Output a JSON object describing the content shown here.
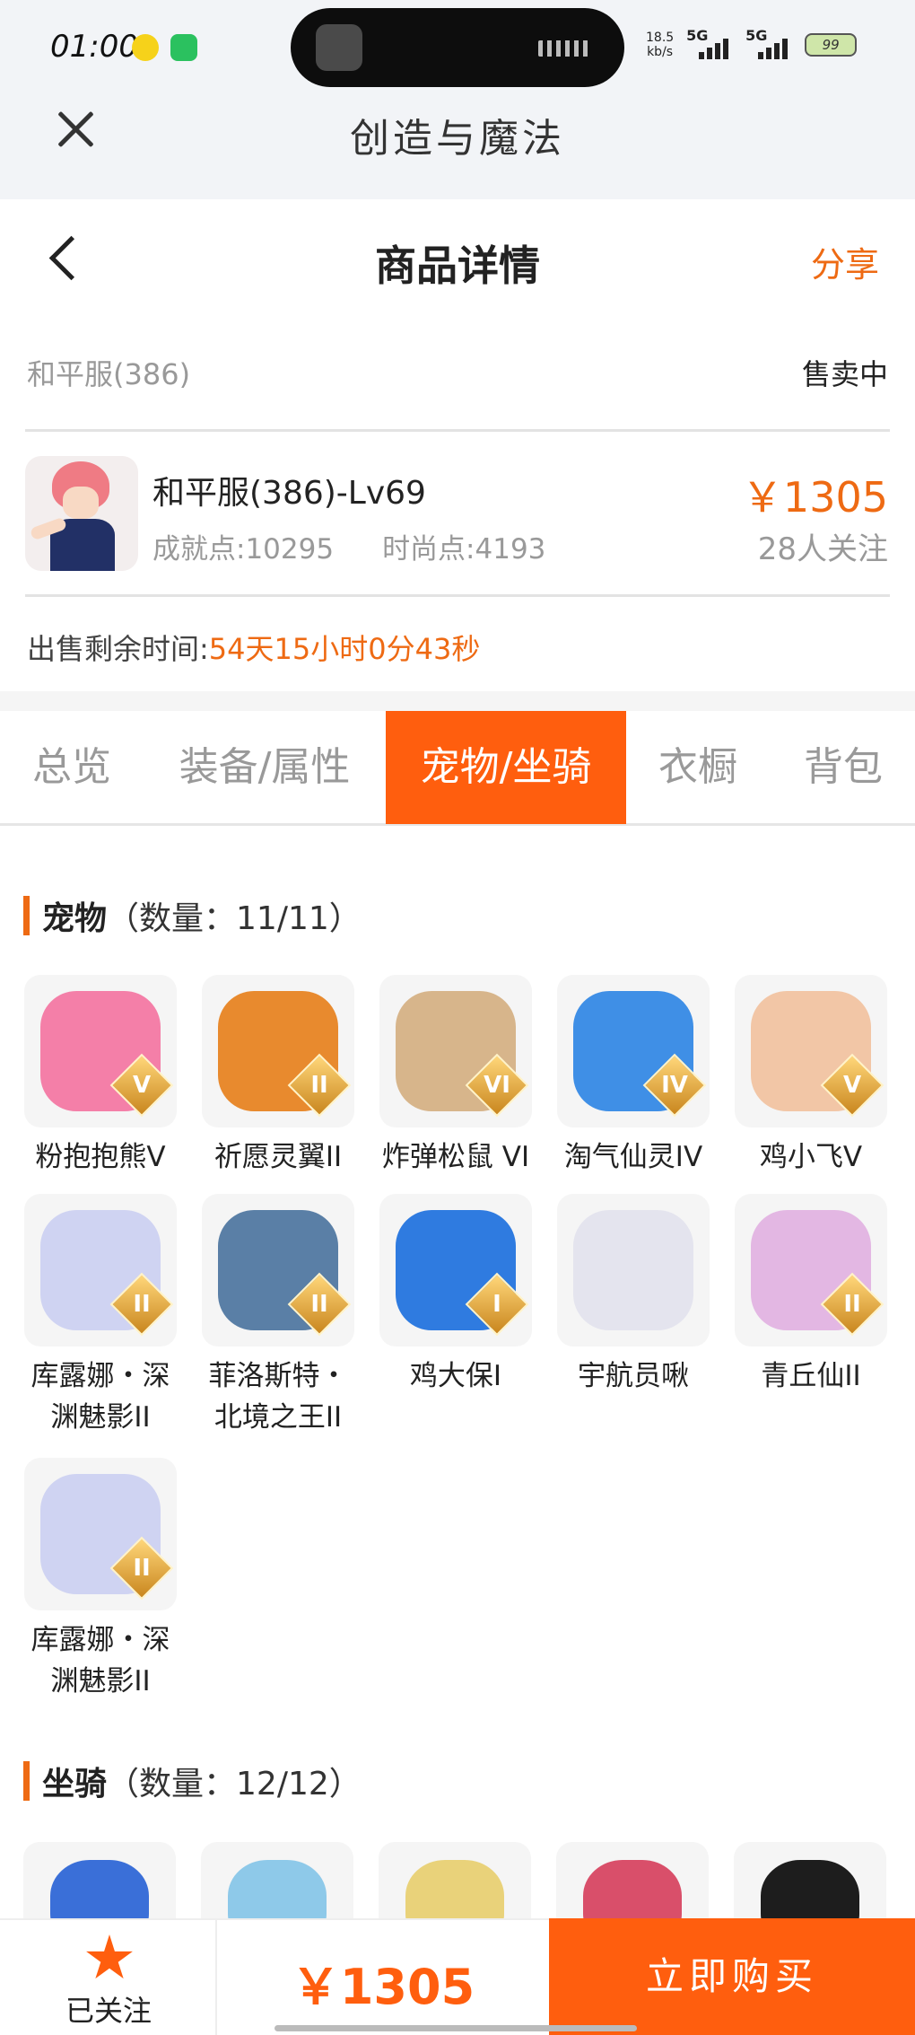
{
  "status_bar": {
    "time": "01:00",
    "speed": "18.5",
    "speed_unit": "kb/s",
    "net1": "5G",
    "net2": "5G",
    "battery": "99"
  },
  "app": {
    "title": "创造与魔法"
  },
  "header": {
    "title": "商品详情",
    "share": "分享"
  },
  "product": {
    "server": "和平服(386)",
    "status": "售卖中",
    "name": "和平服(386)-Lv69",
    "achievement": "成就点:10295",
    "fashion": "时尚点:4193",
    "price": "￥1305",
    "followers": "28人关注",
    "remain_label": "出售剩余时间:",
    "remain_value": "54天15小时0分43秒"
  },
  "tabs": [
    {
      "label": "总览",
      "active": false
    },
    {
      "label": "装备/属性",
      "active": false
    },
    {
      "label": "宠物/坐骑",
      "active": true
    },
    {
      "label": "衣橱",
      "active": false
    },
    {
      "label": "背包",
      "active": false
    }
  ],
  "pets_section": {
    "title": "宠物",
    "count": "（数量：11/11）"
  },
  "pets": [
    {
      "name": "粉抱抱熊Ⅴ",
      "rank": "V",
      "color": "#f47fa8"
    },
    {
      "name": "祈愿灵翼II",
      "rank": "II",
      "color": "#e88a2e"
    },
    {
      "name": "炸弹松鼠 VI",
      "rank": "VI",
      "color": "#d7b58b"
    },
    {
      "name": "淘气仙灵IV",
      "rank": "IV",
      "color": "#3f8fe6"
    },
    {
      "name": "鸡小飞V",
      "rank": "V",
      "color": "#f2c6a6"
    },
    {
      "name": "库露娜・深渊魅影II",
      "rank": "II",
      "color": "#cfd3f2"
    },
    {
      "name": "菲洛斯特・北境之王II",
      "rank": "II",
      "color": "#5a7fa6"
    },
    {
      "name": "鸡大保I",
      "rank": "I",
      "color": "#2f7be0"
    },
    {
      "name": "宇航员啾",
      "rank": "",
      "color": "#e4e4ee"
    },
    {
      "name": "青丘仙II",
      "rank": "II",
      "color": "#e3b7e3"
    },
    {
      "name": "库露娜・深渊魅影II",
      "rank": "II",
      "color": "#cfd3f2"
    }
  ],
  "mounts_section": {
    "title": "坐骑",
    "count": "（数量：12/12）"
  },
  "mount_colors": [
    "#3a6fd8",
    "#8ec9e9",
    "#e9d27a",
    "#d94f6a",
    "#1d1d1d"
  ],
  "bottom": {
    "follow_label": "已关注",
    "price": "￥1305",
    "buy": "立即购买"
  }
}
